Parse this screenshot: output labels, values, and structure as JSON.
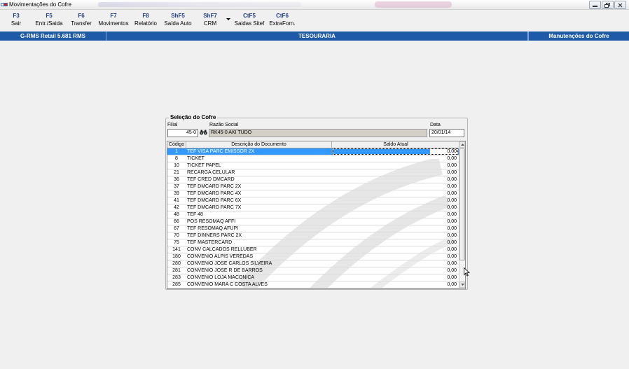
{
  "window": {
    "title": "Movimentações do Cofre"
  },
  "toolbar": {
    "buttons": [
      {
        "key": "F3",
        "label": "Sair"
      },
      {
        "key": "F5",
        "label": "Entr./Saida"
      },
      {
        "key": "F6",
        "label": "Transfer"
      },
      {
        "key": "F7",
        "label": "Movimentos"
      },
      {
        "key": "F8",
        "label": "Relatório"
      },
      {
        "key": "ShF5",
        "label": "Saída Auto"
      },
      {
        "key": "ShF7",
        "label": "CRM"
      },
      {
        "key": "CtF5",
        "label": "Saidas Sitef"
      },
      {
        "key": "CtF6",
        "label": "ExtraForn."
      }
    ]
  },
  "statusbar": {
    "system": "G-RMS Retail 5.681 RMS",
    "module": "TESOURARIA",
    "screen": "Manutenções do Cofre"
  },
  "form": {
    "group_title": "Seleção do Cofre",
    "filial_label": "Filial",
    "filial_value": "45-0",
    "razao_label": "Razão Social",
    "razao_value": "RK45-0 AKI TUDO",
    "data_label": "Data",
    "data_value": "20/01/14"
  },
  "grid": {
    "headers": [
      "Código",
      "Descrição do Documento",
      "Saldo Atual"
    ],
    "rows": [
      {
        "codigo": "1",
        "descricao": "TEF VISA PARC EMISSOR 2X",
        "saldo": "0,00"
      },
      {
        "codigo": "8",
        "descricao": "TICKET",
        "saldo": "0,00"
      },
      {
        "codigo": "10",
        "descricao": "TICKET PAPEL",
        "saldo": "0,00"
      },
      {
        "codigo": "21",
        "descricao": "RECARGA CELULAR",
        "saldo": "0,00"
      },
      {
        "codigo": "36",
        "descricao": "TEF CRED DMCARD",
        "saldo": "0,00"
      },
      {
        "codigo": "37",
        "descricao": "TEF DMCARD PARC 2X",
        "saldo": "0,00"
      },
      {
        "codigo": "39",
        "descricao": "TEF DMCARD PARC 4X",
        "saldo": "0,00"
      },
      {
        "codigo": "41",
        "descricao": "TEF DMCARD PARC 6X",
        "saldo": "0,00"
      },
      {
        "codigo": "42",
        "descricao": "TEF DMCARD PARC 7X",
        "saldo": "0,00"
      },
      {
        "codigo": "48",
        "descricao": "TEF 48",
        "saldo": "0,00"
      },
      {
        "codigo": "66",
        "descricao": "POS RESOMAQ AFFI",
        "saldo": "0,00"
      },
      {
        "codigo": "67",
        "descricao": "TEF RESOMAQ AFUPI",
        "saldo": "0,00"
      },
      {
        "codigo": "70",
        "descricao": "TEF DINNERS PARC 2X",
        "saldo": "0,00"
      },
      {
        "codigo": "75",
        "descricao": "TEF MASTERCARD",
        "saldo": "0,00"
      },
      {
        "codigo": "141",
        "descricao": "CONV CALCADOS RELLUBER",
        "saldo": "0,00"
      },
      {
        "codigo": "180",
        "descricao": "CONVENIO ALPIS VEREDAS",
        "saldo": "0,00"
      },
      {
        "codigo": "280",
        "descricao": "CONVENIO JOSE CARLOS SILVEIRA",
        "saldo": "0,00"
      },
      {
        "codigo": "281",
        "descricao": "CONVENIO JOSE R DE BARROS",
        "saldo": "0,00"
      },
      {
        "codigo": "283",
        "descricao": "CONVENIO LOJA MACONICA",
        "saldo": "0,00"
      },
      {
        "codigo": "285",
        "descricao": "CONVENIO MARA C COSTA ALVES",
        "saldo": "0,00"
      }
    ]
  },
  "colors": {
    "statusbar": "#1e5aa8",
    "toolbar_key": "#1f3b86",
    "selection": "#3399ff"
  }
}
